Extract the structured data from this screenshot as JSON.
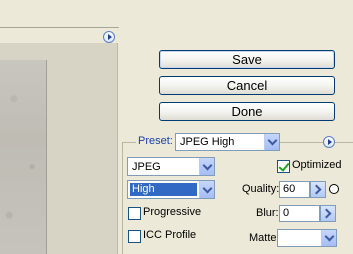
{
  "buttons": {
    "save": "Save",
    "cancel": "Cancel",
    "done": "Done"
  },
  "settings": {
    "preset_label": "Preset:",
    "preset_value": "JPEG High",
    "format_value": "JPEG",
    "quality_level_value": "High",
    "optimized_label": "Optimized",
    "optimized_checked": true,
    "progressive_label": "Progressive",
    "progressive_checked": false,
    "icc_label": "ICC Profile",
    "icc_checked": false,
    "quality_label": "Quality:",
    "quality_value": "60",
    "blur_label": "Blur:",
    "blur_value": "0",
    "matte_label": "Matte:",
    "matte_value": ""
  },
  "icons": {
    "preview_menu": "flyout-arrow-icon",
    "settings_menu": "flyout-arrow-icon",
    "quality_extra": "mask-circle-icon"
  }
}
